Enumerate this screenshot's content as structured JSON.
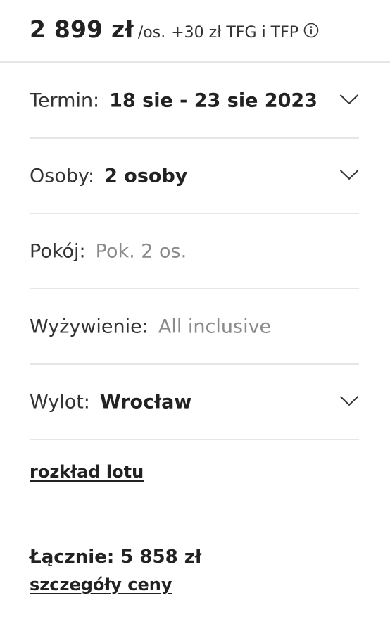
{
  "price": {
    "amount": "2 899 zł",
    "unit": "/os.",
    "extra": "+30 zł TFG i TFP",
    "info_icon": "info-circle-icon"
  },
  "options": {
    "term": {
      "label": "Termin:",
      "value": "18 sie - 23 sie 2023",
      "icon": "chevron-down-icon"
    },
    "persons": {
      "label": "Osoby:",
      "value": "2 osoby",
      "icon": "chevron-down-icon"
    },
    "room": {
      "label": "Pokój:",
      "value": "Pok. 2 os."
    },
    "board": {
      "label": "Wyżywienie:",
      "value": "All inclusive"
    },
    "departure": {
      "label": "Wylot:",
      "value": "Wrocław",
      "icon": "chevron-down-icon"
    }
  },
  "links": {
    "flight_schedule": "rozkład lotu",
    "price_details": "szczegóły ceny"
  },
  "total": {
    "text": "Łącznie: 5 858 zł"
  },
  "colors": {
    "text": "#222222",
    "muted": "#8a8a8a",
    "divider": "#e6e6e6"
  }
}
